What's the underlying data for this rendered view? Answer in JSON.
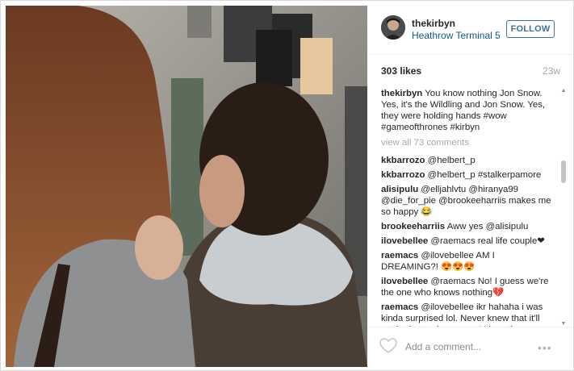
{
  "post": {
    "username": "thekirbyn",
    "location": "Heathrow Terminal 5",
    "follow_label": "FOLLOW",
    "likes": "303 likes",
    "time_ago": "23w",
    "caption": "You know nothing Jon Snow. Yes, it's the Wildling and Jon Snow. Yes, they were holding hands #wow #gameofthrones #kirbyn",
    "view_all": "view all 73 comments",
    "add_comment_placeholder": "Add a comment...",
    "more_icon_text": "•••"
  },
  "comments": [
    {
      "user": "kkbarrozo",
      "text": "@helbert_p"
    },
    {
      "user": "kkbarrozo",
      "text": "@helbert_p #stalkerpamore"
    },
    {
      "user": "alisipulu",
      "text": "@elljahlvtu @hiranya99 @die_for_pie @brookeeharriis makes me so happy 😂"
    },
    {
      "user": "brookeeharriis",
      "text": "Aww yes @alisipulu"
    },
    {
      "user": "ilovebellee",
      "text": "@raemacs real life couple❤"
    },
    {
      "user": "raemacs",
      "text": "@ilovebellee AM I DREAMING?! 😍😍😍"
    },
    {
      "user": "ilovebellee",
      "text": "@raemacs No! I guess we're the one who knows nothing💔"
    },
    {
      "user": "raemacs",
      "text": "@ilovebellee ikr hahaha i was kinda surprised lol. Never knew that it'll not be just a dream, coz' I love them ♥"
    }
  ],
  "icons": {
    "heart": "heart-outline-icon",
    "more": "more-options-icon"
  },
  "colors": {
    "link": "#125688",
    "follow": "#3f729b",
    "muted": "#a5a7aa"
  }
}
